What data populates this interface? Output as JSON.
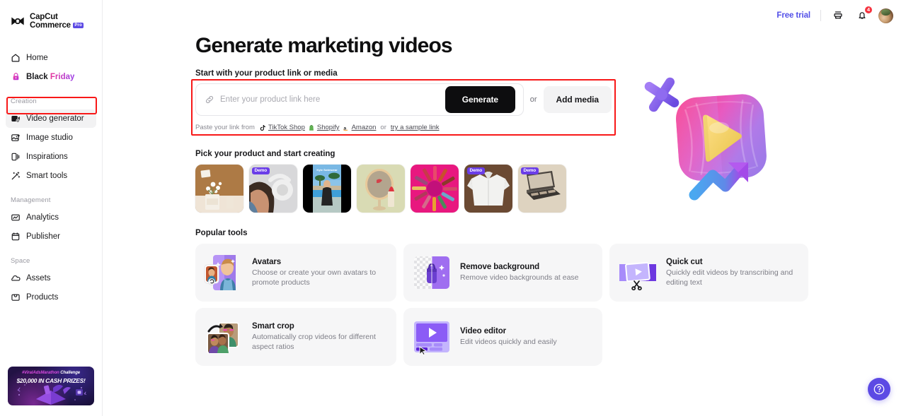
{
  "brand": {
    "line1": "CapCut",
    "line2": "Commerce",
    "pro_badge": "Pro",
    "logo_icon": "capcut-logo-icon"
  },
  "sidebar": {
    "top_items": [
      {
        "label": "Home",
        "icon": "home-icon",
        "name": "home"
      },
      {
        "label_part1": "Black ",
        "label_part2": "Friday",
        "icon": "lock-icon",
        "name": "black-friday"
      }
    ],
    "sections": [
      {
        "label": "Creation",
        "items": [
          {
            "label": "Video generator",
            "icon": "video-generator-icon",
            "name": "video-generator",
            "active": true
          },
          {
            "label": "Image studio",
            "icon": "image-studio-icon",
            "name": "image-studio",
            "active": false
          },
          {
            "label": "Inspirations",
            "icon": "inspirations-icon",
            "name": "inspirations",
            "active": false
          },
          {
            "label": "Smart tools",
            "icon": "smart-tools-icon",
            "name": "smart-tools",
            "active": false
          }
        ]
      },
      {
        "label": "Management",
        "items": [
          {
            "label": "Analytics",
            "icon": "analytics-icon",
            "name": "analytics",
            "active": false
          },
          {
            "label": "Publisher",
            "icon": "publisher-icon",
            "name": "publisher",
            "active": false
          }
        ]
      },
      {
        "label": "Space",
        "items": [
          {
            "label": "Assets",
            "icon": "assets-cloud-icon",
            "name": "assets",
            "active": false
          },
          {
            "label": "Products",
            "icon": "products-icon",
            "name": "products",
            "active": false
          }
        ]
      }
    ],
    "promo": {
      "hashtag": "#ViralAdsMarathon",
      "challenge": " Challenge",
      "prize": "$20,000 IN CASH PRIZES!"
    }
  },
  "topbar": {
    "free_trial": "Free trial",
    "print_icon": "printer-icon",
    "bell_icon": "bell-icon",
    "notification_count": "4",
    "avatar": "user-avatar"
  },
  "main": {
    "title": "Generate marketing videos",
    "start_label": "Start with your product link or media",
    "input": {
      "placeholder": "Enter your product link here",
      "value": "",
      "icon": "link-icon"
    },
    "generate_label": "Generate",
    "or_label": "or",
    "add_media_label": "Add media",
    "paste": {
      "prefix": "Paste your link from",
      "sources": [
        {
          "label": "TikTok Shop",
          "icon": "tiktok-icon"
        },
        {
          "label": "Shopify",
          "icon": "shopify-icon"
        },
        {
          "label": "Amazon",
          "icon": "amazon-icon"
        }
      ],
      "or": "or",
      "sample_link": "try a sample link"
    },
    "hero_icon": "play-button-3d-illustration"
  },
  "picker": {
    "label": "Pick your product and start creating",
    "demo_label": "Demo",
    "thumbs": [
      {
        "name": "flowers-vase",
        "demo": false
      },
      {
        "name": "headphones-man",
        "demo": true
      },
      {
        "name": "woman-poolside-video",
        "demo": false
      },
      {
        "name": "mirror-lipstick",
        "demo": false
      },
      {
        "name": "lipstick-wheel",
        "demo": false
      },
      {
        "name": "white-shirt",
        "demo": true
      },
      {
        "name": "eyeshadow-palette",
        "demo": true
      }
    ]
  },
  "tools": {
    "label": "Popular tools",
    "row1": [
      {
        "name": "Avatars",
        "desc": "Choose or create your own avatars to promote products",
        "icon": "avatars-icon"
      },
      {
        "name": "Remove background",
        "desc": "Remove video backgrounds at ease",
        "icon": "remove-background-icon"
      },
      {
        "name": "Quick cut",
        "desc": "Quickly edit videos by transcribing and editing text",
        "icon": "quick-cut-icon"
      }
    ],
    "row2": [
      {
        "name": "Smart crop",
        "desc": "Automatically crop videos for different aspect ratios",
        "icon": "smart-crop-icon"
      },
      {
        "name": "Video editor",
        "desc": "Edit videos quickly and easily",
        "icon": "video-editor-icon"
      }
    ]
  },
  "help": {
    "icon": "help-question-icon"
  },
  "colors": {
    "accent_purple": "#5c4ae4",
    "free_trial": "#5350e8",
    "annotation_red": "#f81818",
    "badge_red": "#f5333f",
    "demo_badge": "#6a3de8",
    "generate_bg": "#0d0d0f",
    "card_bg": "#f6f6f7"
  }
}
